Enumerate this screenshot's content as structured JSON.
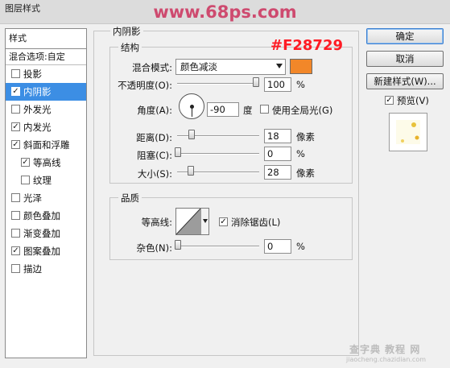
{
  "window": {
    "title": "图层样式"
  },
  "watermark_top": "www.68ps.com",
  "watermark_bottom": {
    "main": "查字典 教程 网",
    "sub": "jiaocheng.chazidian.com"
  },
  "styles_panel": {
    "header": "样式",
    "blend_options": "混合选项:自定",
    "items": [
      {
        "label": "投影",
        "checked": false,
        "selected": false,
        "indent": false
      },
      {
        "label": "内阴影",
        "checked": true,
        "selected": true,
        "indent": false
      },
      {
        "label": "外发光",
        "checked": false,
        "selected": false,
        "indent": false
      },
      {
        "label": "内发光",
        "checked": true,
        "selected": false,
        "indent": false
      },
      {
        "label": "斜面和浮雕",
        "checked": true,
        "selected": false,
        "indent": false
      },
      {
        "label": "等高线",
        "checked": true,
        "selected": false,
        "indent": true
      },
      {
        "label": "纹理",
        "checked": false,
        "selected": false,
        "indent": true
      },
      {
        "label": "光泽",
        "checked": false,
        "selected": false,
        "indent": false
      },
      {
        "label": "颜色叠加",
        "checked": false,
        "selected": false,
        "indent": false
      },
      {
        "label": "渐变叠加",
        "checked": false,
        "selected": false,
        "indent": false
      },
      {
        "label": "图案叠加",
        "checked": true,
        "selected": false,
        "indent": false
      },
      {
        "label": "描边",
        "checked": false,
        "selected": false,
        "indent": false
      }
    ]
  },
  "inner_shadow": {
    "section_title": "内阴影",
    "structure": {
      "title": "结构",
      "color_annotation": "#F28729",
      "color": "#F28729",
      "blend_mode_label": "混合模式:",
      "blend_mode_value": "颜色减淡",
      "opacity_label": "不透明度(O):",
      "opacity_value": "100",
      "opacity_unit": "%",
      "angle_label": "角度(A):",
      "angle_value": "-90",
      "angle_unit": "度",
      "global_light_label": "使用全局光(G)",
      "global_light_checked": false,
      "distance_label": "距离(D):",
      "distance_value": "18",
      "distance_unit": "像素",
      "choke_label": "阻塞(C):",
      "choke_value": "0",
      "choke_unit": "%",
      "size_label": "大小(S):",
      "size_value": "28",
      "size_unit": "像素"
    },
    "quality": {
      "title": "品质",
      "contour_label": "等高线:",
      "anti_alias_label": "消除锯齿(L)",
      "anti_alias_checked": true,
      "noise_label": "杂色(N):",
      "noise_value": "0",
      "noise_unit": "%"
    }
  },
  "buttons": {
    "ok": "确定",
    "cancel": "取消",
    "new_style": "新建样式(W)...",
    "preview_label": "预览(V)",
    "preview_checked": true
  },
  "icons": {
    "check": "check-icon",
    "dropdown": "chevron-down-icon",
    "angle_dial": "angle-dial-icon",
    "contour_curve": "contour-curve-icon"
  }
}
